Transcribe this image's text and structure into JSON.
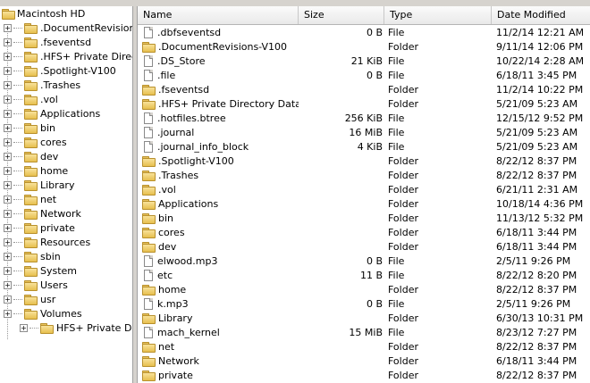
{
  "tree": {
    "root_label": "Macintosh HD",
    "items": [
      {
        "label": ".DocumentRevisions-V",
        "expander": "+"
      },
      {
        "label": ".fseventsd",
        "expander": "+"
      },
      {
        "label": ".HFS+ Private Director",
        "expander": "+"
      },
      {
        "label": ".Spotlight-V100",
        "expander": "+"
      },
      {
        "label": ".Trashes",
        "expander": "+"
      },
      {
        "label": ".vol",
        "expander": "+"
      },
      {
        "label": "Applications",
        "expander": "+"
      },
      {
        "label": "bin",
        "expander": "+"
      },
      {
        "label": "cores",
        "expander": "+"
      },
      {
        "label": "dev",
        "expander": "+"
      },
      {
        "label": "home",
        "expander": "+"
      },
      {
        "label": "Library",
        "expander": "+"
      },
      {
        "label": "net",
        "expander": "+"
      },
      {
        "label": "Network",
        "expander": "+"
      },
      {
        "label": "private",
        "expander": "+"
      },
      {
        "label": "Resources",
        "expander": "+"
      },
      {
        "label": "sbin",
        "expander": "+"
      },
      {
        "label": "System",
        "expander": "+"
      },
      {
        "label": "Users",
        "expander": "+"
      },
      {
        "label": "usr",
        "expander": "+"
      },
      {
        "label": "Volumes",
        "expander": "+"
      },
      {
        "label": "HFS+ Private Dat",
        "expander": "+"
      }
    ]
  },
  "list": {
    "columns": {
      "name": "Name",
      "size": "Size",
      "type": "Type",
      "date": "Date Modified"
    },
    "rows": [
      {
        "icon": "file",
        "name": ".dbfseventsd",
        "size": "0 B",
        "type": "File",
        "date": "11/2/14 12:21 AM"
      },
      {
        "icon": "folder",
        "name": ".DocumentRevisions-V100",
        "size": "",
        "type": "Folder",
        "date": "9/11/14 12:06 PM"
      },
      {
        "icon": "file",
        "name": ".DS_Store",
        "size": "21 KiB",
        "type": "File",
        "date": "10/22/14 2:28 AM"
      },
      {
        "icon": "file",
        "name": ".file",
        "size": "0 B",
        "type": "File",
        "date": "6/18/11 3:45 PM"
      },
      {
        "icon": "folder",
        "name": ".fseventsd",
        "size": "",
        "type": "Folder",
        "date": "11/2/14 10:22 PM"
      },
      {
        "icon": "folder",
        "name": ".HFS+ Private Directory Data",
        "size": "",
        "type": "Folder",
        "date": "5/21/09 5:23 AM"
      },
      {
        "icon": "file",
        "name": ".hotfiles.btree",
        "size": "256 KiB",
        "type": "File",
        "date": "12/15/12 9:52 PM"
      },
      {
        "icon": "file",
        "name": ".journal",
        "size": "16 MiB",
        "type": "File",
        "date": "5/21/09 5:23 AM"
      },
      {
        "icon": "file",
        "name": ".journal_info_block",
        "size": "4 KiB",
        "type": "File",
        "date": "5/21/09 5:23 AM"
      },
      {
        "icon": "folder",
        "name": ".Spotlight-V100",
        "size": "",
        "type": "Folder",
        "date": "8/22/12 8:37 PM"
      },
      {
        "icon": "folder",
        "name": ".Trashes",
        "size": "",
        "type": "Folder",
        "date": "8/22/12 8:37 PM"
      },
      {
        "icon": "folder",
        "name": ".vol",
        "size": "",
        "type": "Folder",
        "date": "6/21/11 2:31 AM"
      },
      {
        "icon": "folder",
        "name": "Applications",
        "size": "",
        "type": "Folder",
        "date": "10/18/14 4:36 PM"
      },
      {
        "icon": "folder",
        "name": "bin",
        "size": "",
        "type": "Folder",
        "date": "11/13/12 5:32 PM"
      },
      {
        "icon": "folder",
        "name": "cores",
        "size": "",
        "type": "Folder",
        "date": "6/18/11 3:44 PM"
      },
      {
        "icon": "folder",
        "name": "dev",
        "size": "",
        "type": "Folder",
        "date": "6/18/11 3:44 PM"
      },
      {
        "icon": "file",
        "name": "elwood.mp3",
        "size": "0 B",
        "type": "File",
        "date": "2/5/11 9:26 PM"
      },
      {
        "icon": "file",
        "name": "etc",
        "size": "11 B",
        "type": "File",
        "date": "8/22/12 8:20 PM"
      },
      {
        "icon": "folder",
        "name": "home",
        "size": "",
        "type": "Folder",
        "date": "8/22/12 8:37 PM"
      },
      {
        "icon": "file",
        "name": "k.mp3",
        "size": "0 B",
        "type": "File",
        "date": "2/5/11 9:26 PM"
      },
      {
        "icon": "folder",
        "name": "Library",
        "size": "",
        "type": "Folder",
        "date": "6/30/13 10:31 PM"
      },
      {
        "icon": "file",
        "name": "mach_kernel",
        "size": "15 MiB",
        "type": "File",
        "date": "8/23/12 7:27 PM"
      },
      {
        "icon": "folder",
        "name": "net",
        "size": "",
        "type": "Folder",
        "date": "8/22/12 8:37 PM"
      },
      {
        "icon": "folder",
        "name": "Network",
        "size": "",
        "type": "Folder",
        "date": "6/18/11 3:44 PM"
      },
      {
        "icon": "folder",
        "name": "private",
        "size": "",
        "type": "Folder",
        "date": "8/22/12 8:37 PM"
      }
    ]
  }
}
